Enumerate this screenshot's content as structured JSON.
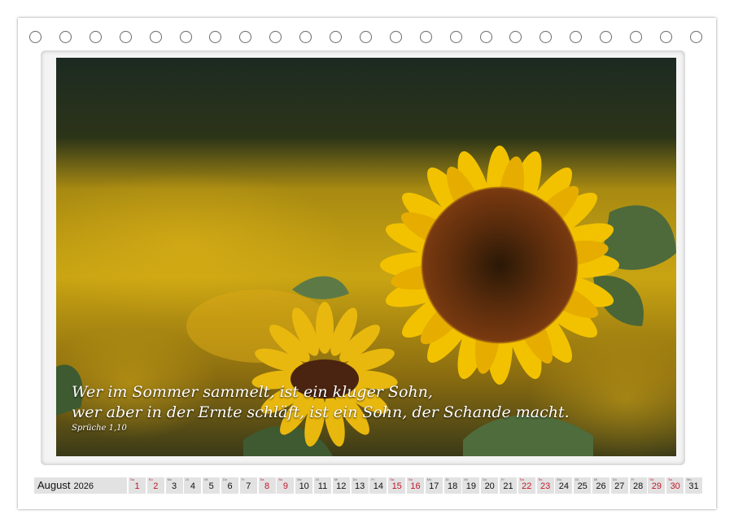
{
  "quote": {
    "line1": "Wer im Sommer sammelt, ist ein kluger Sohn,",
    "line2": "wer aber in der Ernte schläft, ist ein Sohn, der Schande macht.",
    "source": "Sprüche 1,10"
  },
  "calendar": {
    "month": "August",
    "year": "2026",
    "days": [
      {
        "wd": "Sa",
        "n": "1",
        "we": true
      },
      {
        "wd": "So",
        "n": "2",
        "we": true
      },
      {
        "wd": "Mo",
        "n": "3",
        "we": false
      },
      {
        "wd": "Di",
        "n": "4",
        "we": false
      },
      {
        "wd": "Mi",
        "n": "5",
        "we": false
      },
      {
        "wd": "Do",
        "n": "6",
        "we": false
      },
      {
        "wd": "Fr",
        "n": "7",
        "we": false
      },
      {
        "wd": "Sa",
        "n": "8",
        "we": true
      },
      {
        "wd": "So",
        "n": "9",
        "we": true
      },
      {
        "wd": "Mo",
        "n": "10",
        "we": false
      },
      {
        "wd": "Di",
        "n": "11",
        "we": false
      },
      {
        "wd": "Mi",
        "n": "12",
        "we": false
      },
      {
        "wd": "Do",
        "n": "13",
        "we": false
      },
      {
        "wd": "Fr",
        "n": "14",
        "we": false
      },
      {
        "wd": "Sa",
        "n": "15",
        "we": true
      },
      {
        "wd": "So",
        "n": "16",
        "we": true
      },
      {
        "wd": "Mo",
        "n": "17",
        "we": false
      },
      {
        "wd": "Di",
        "n": "18",
        "we": false
      },
      {
        "wd": "Mi",
        "n": "19",
        "we": false
      },
      {
        "wd": "Do",
        "n": "20",
        "we": false
      },
      {
        "wd": "Fr",
        "n": "21",
        "we": false
      },
      {
        "wd": "Sa",
        "n": "22",
        "we": true
      },
      {
        "wd": "So",
        "n": "23",
        "we": true
      },
      {
        "wd": "Mo",
        "n": "24",
        "we": false
      },
      {
        "wd": "Di",
        "n": "25",
        "we": false
      },
      {
        "wd": "Mi",
        "n": "26",
        "we": false
      },
      {
        "wd": "Do",
        "n": "27",
        "we": false
      },
      {
        "wd": "Fr",
        "n": "28",
        "we": false
      },
      {
        "wd": "Sa",
        "n": "29",
        "we": true
      },
      {
        "wd": "So",
        "n": "30",
        "we": true
      },
      {
        "wd": "Mo",
        "n": "31",
        "we": false
      }
    ]
  },
  "colors": {
    "weekend": "#c0182a",
    "cell": "#e2e2e2",
    "petal": "#f2c200",
    "seedhead": "#5a2a10"
  }
}
